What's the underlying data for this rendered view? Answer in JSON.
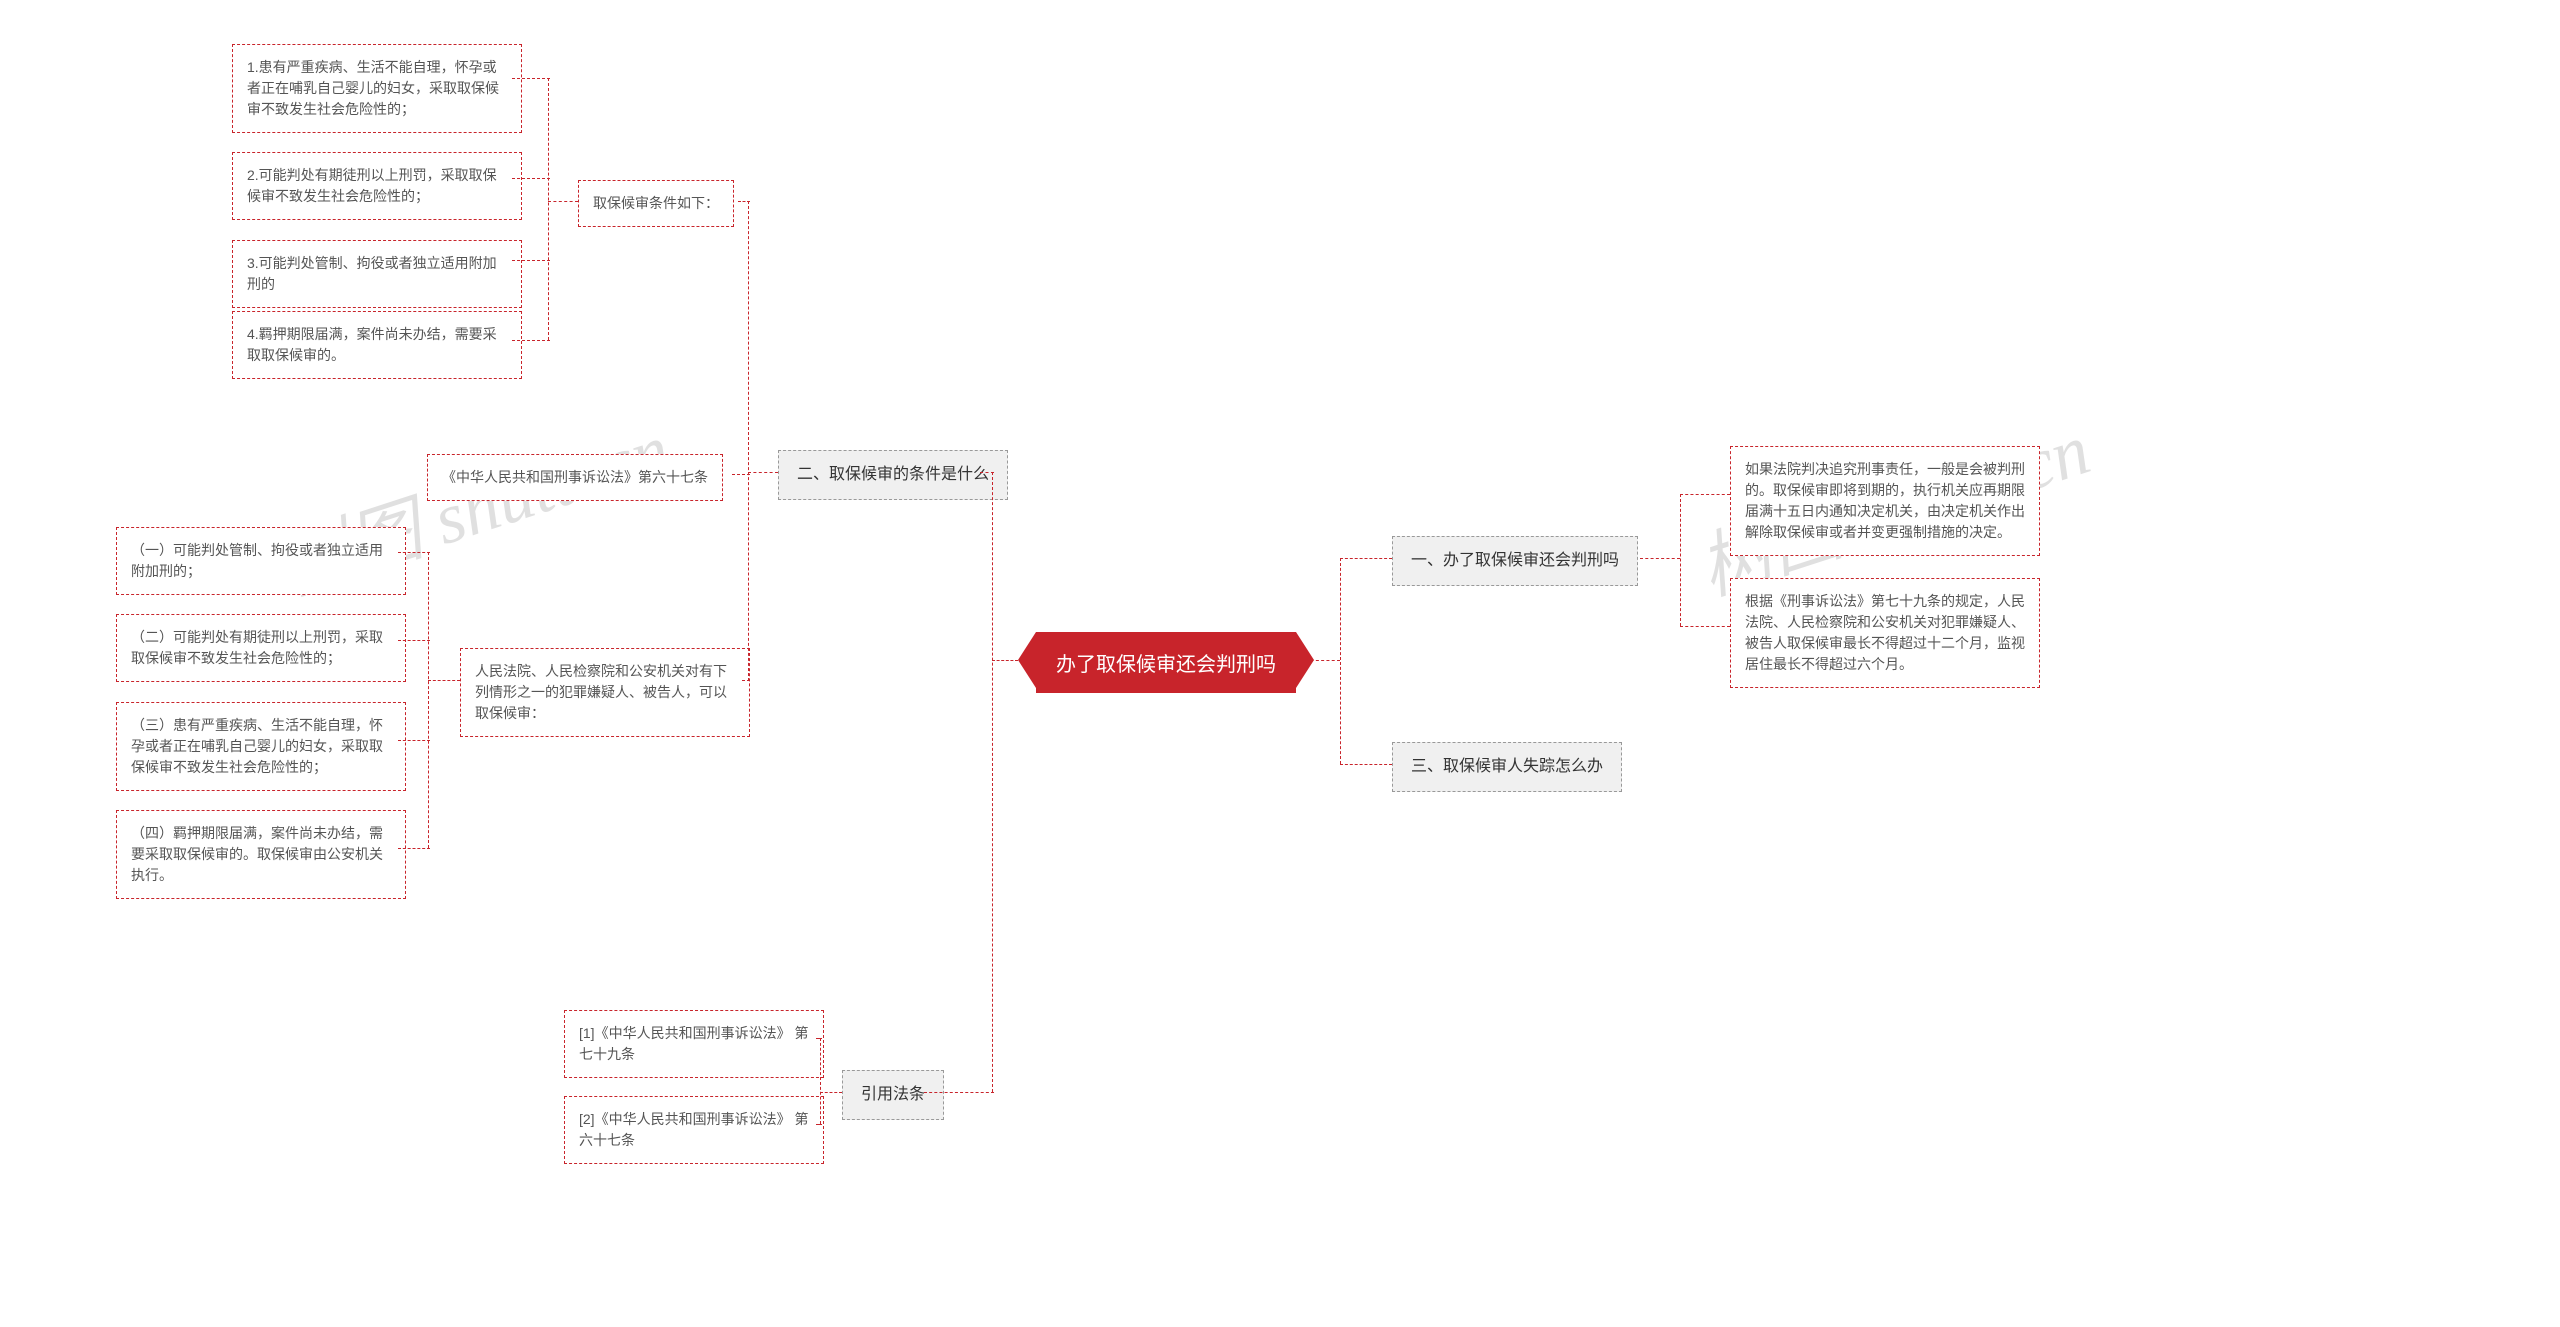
{
  "root": {
    "label": "办了取保候审还会判刑吗"
  },
  "right": {
    "b1": {
      "label": "一、办了取保候审还会判刑吗",
      "leaves": [
        "如果法院判决追究刑事责任，一般是会被判刑的。取保候审即将到期的，执行机关应再期限届满十五日内通知决定机关，由决定机关作出解除取保候审或者并变更强制措施的决定。",
        "根据《刑事诉讼法》第七十九条的规定，人民法院、人民检察院和公安机关对犯罪嫌疑人、被告人取保候审最长不得超过十二个月，监视居住最长不得超过六个月。"
      ]
    },
    "b2": {
      "label": "三、取保候审人失踪怎么办"
    }
  },
  "left": {
    "b_conditions": {
      "label": "二、取保候审的条件是什么",
      "sub_a": {
        "label": "取保候审条件如下：",
        "leaves": [
          "1.患有严重疾病、生活不能自理，怀孕或者正在哺乳自己婴儿的妇女，采取取保候审不致发生社会危险性的；",
          "2.可能判处有期徒刑以上刑罚，采取取保候审不致发生社会危险性的；",
          "3.可能判处管制、拘役或者独立适用附加刑的",
          "4.羁押期限届满，案件尚未办结，需要采取取保候审的。"
        ]
      },
      "sub_b": {
        "label": "《中华人民共和国刑事诉讼法》第六十七条"
      },
      "sub_c": {
        "label": "人民法院、人民检察院和公安机关对有下列情形之一的犯罪嫌疑人、被告人，可以取保候审：",
        "leaves": [
          "（一）可能判处管制、拘役或者独立适用附加刑的；",
          "（二）可能判处有期徒刑以上刑罚，采取取保候审不致发生社会危险性的；",
          "（三）患有严重疾病、生活不能自理，怀孕或者正在哺乳自己婴儿的妇女，采取取保候审不致发生社会危险性的；",
          "（四）羁押期限届满，案件尚未办结，需要采取取保候审的。取保候审由公安机关执行。"
        ]
      }
    },
    "b_cite": {
      "label": "引用法条",
      "leaves": [
        "[1]《中华人民共和国刑事诉讼法》 第七十九条",
        "[2]《中华人民共和国刑事诉讼法》 第六十七条"
      ]
    }
  },
  "watermarks": [
    "树图 shutu.cn",
    "树图 shutu.cn"
  ]
}
